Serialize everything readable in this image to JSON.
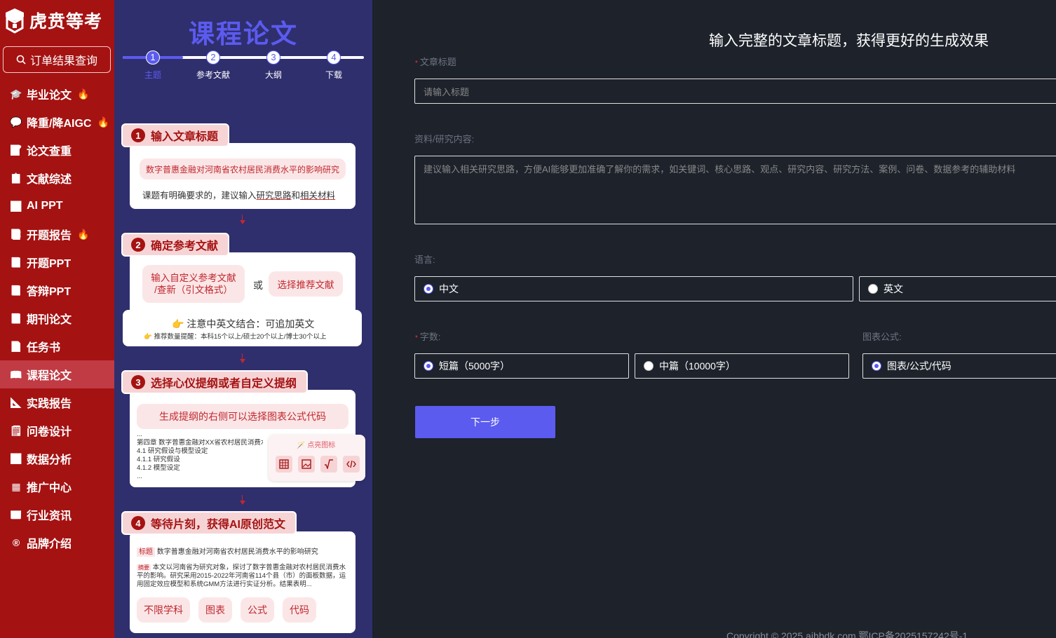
{
  "brand": {
    "name": "虎贲等考",
    "color": "#a51212",
    "accent": "#5b5bf0"
  },
  "sidebar": {
    "order_query": "订单结果查询",
    "items": [
      {
        "label": "毕业论文",
        "icon": "graduation-cap-icon",
        "hot": true
      },
      {
        "label": "降重/降AIGC",
        "icon": "chat-icon",
        "hot": true
      },
      {
        "label": "论文查重",
        "icon": "document-check-icon",
        "hot": false
      },
      {
        "label": "文献综述",
        "icon": "list-icon",
        "hot": false
      },
      {
        "label": "AI PPT",
        "icon": "ppt-icon",
        "hot": false
      },
      {
        "label": "开题报告",
        "icon": "report-icon",
        "hot": true
      },
      {
        "label": "开题PPT",
        "icon": "book-icon",
        "hot": false
      },
      {
        "label": "答辩PPT",
        "icon": "book-icon",
        "hot": false
      },
      {
        "label": "期刊论文",
        "icon": "journal-icon",
        "hot": false
      },
      {
        "label": "任务书",
        "icon": "task-icon",
        "hot": false
      },
      {
        "label": "课程论文",
        "icon": "course-icon",
        "hot": false,
        "active": true
      },
      {
        "label": "实践报告",
        "icon": "practice-icon",
        "hot": false
      },
      {
        "label": "问卷设计",
        "icon": "survey-icon",
        "hot": false
      },
      {
        "label": "数据分析",
        "icon": "chart-icon",
        "hot": false
      },
      {
        "label": "推广中心",
        "icon": "grid-icon",
        "hot": false
      },
      {
        "label": "行业资讯",
        "icon": "news-icon",
        "hot": false
      },
      {
        "label": "品牌介绍",
        "icon": "registered-icon",
        "hot": false
      }
    ]
  },
  "guide": {
    "title": "课程论文",
    "steps": [
      {
        "num": "1",
        "label": "主题"
      },
      {
        "num": "2",
        "label": "参考文献"
      },
      {
        "num": "3",
        "label": "大纲"
      },
      {
        "num": "4",
        "label": "下载"
      }
    ],
    "step1": {
      "tag": "输入文章标题",
      "example": "数字普惠金融对河南省农村居民消费水平的影响研究",
      "tip_prefix": "课题有明确要求的，建议输入",
      "tip_u1": "研究思路",
      "tip_mid": "和",
      "tip_u2": "相关材料"
    },
    "step2": {
      "tag": "确定参考文献",
      "custom": "输入自定义参考文献\n/查新（引文格式）",
      "or": "或",
      "recommend": "选择推荐文献",
      "note": "注意中英文结合：可追加英文",
      "sub_note": "推荐数量提醒：本科15个以上/硕士20个以上/博士30个以上"
    },
    "step3": {
      "tag": "选择心仪提纲或者自定义提纲",
      "pill": "生成提纲的右侧可以选择图表公式代码",
      "outline": [
        "...",
        "第四章 数字普惠金融对XX省农村居民消费水平",
        "4.1 研究假设与模型设定",
        "4.1.1 研究假设",
        "4.1.2 模型设定",
        "..."
      ],
      "click_hint": "点亮图标"
    },
    "step4": {
      "tag": "等待片刻，获得AI原创范文",
      "title_tag": "标题",
      "title_text": "数字普惠金融对河南省农村居民消费水平的影响研究",
      "abstract_tag": "摘要",
      "abstract_text": "本文以河南省为研究对象，探讨了数字普惠金融对农村居民消费水平的影响。研究采用2015-2022年河南省114个县（市）的面板数据，运用固定效应模型和系统GMM方法进行实证分析。结果表明...",
      "chips": [
        "不限学科",
        "图表",
        "公式",
        "代码"
      ]
    }
  },
  "form": {
    "hint": "输入完整的文章标题，获得更好的生成效果",
    "title_label": "文章标题",
    "title_placeholder": "请输入标题",
    "material_label": "资料/研究内容:",
    "material_placeholder": "建议输入相关研究思路，方便AI能够更加准确了解你的需求，如关键词、核心思路、观点、研究内容、研究方法、案例、问卷、数据参考的辅助材料",
    "language_label": "语言:",
    "lang_zh": "中文",
    "lang_en": "英文",
    "words_label": "字数:",
    "short": "短篇（5000字）",
    "medium": "中篇（10000字）",
    "chart_label": "图表公式:",
    "chart_opt": "图表/公式/代码",
    "next": "下一步"
  },
  "footer": {
    "copyright": "Copyright © 2025 aihbdk.com 鄂ICP备2025157242号-1"
  }
}
